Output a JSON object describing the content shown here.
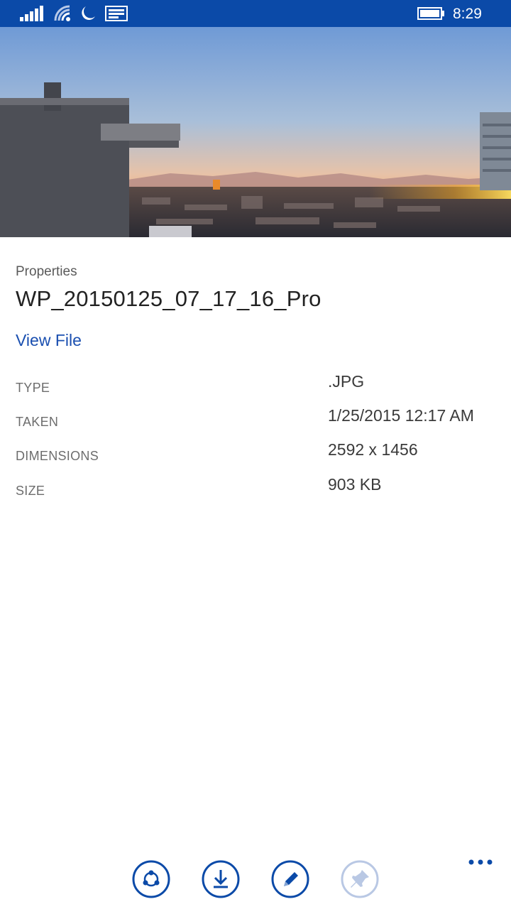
{
  "status_bar": {
    "time": "8:29",
    "icons": [
      "signal-icon",
      "wifi-icon",
      "quiet-hours-icon",
      "message-icon",
      "battery-icon"
    ]
  },
  "colors": {
    "accent": "#0b4aa8",
    "link": "#1a4fb0",
    "disabled": "#b9c8e4"
  },
  "properties": {
    "heading": "Properties",
    "file_name": "WP_20150125_07_17_16_Pro",
    "view_file_label": "View File",
    "rows": [
      {
        "label": "TYPE",
        "value": ".JPG"
      },
      {
        "label": "TAKEN",
        "value": "1/25/2015 12:17 AM"
      },
      {
        "label": "DIMENSIONS",
        "value": "2592 x 1456"
      },
      {
        "label": "SIZE",
        "value": "903 KB"
      }
    ]
  },
  "app_bar": {
    "buttons": [
      {
        "icon": "share-icon",
        "enabled": true
      },
      {
        "icon": "download-icon",
        "enabled": true
      },
      {
        "icon": "edit-icon",
        "enabled": true
      },
      {
        "icon": "pin-icon",
        "enabled": false
      }
    ],
    "more_icon": "more-icon"
  }
}
